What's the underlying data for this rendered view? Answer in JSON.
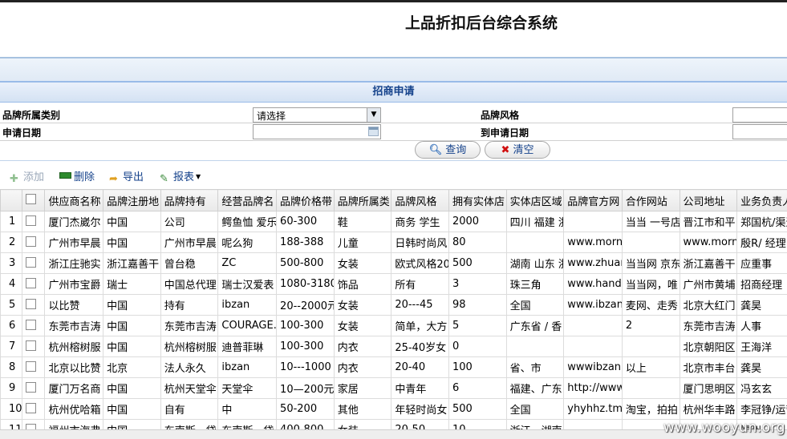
{
  "app": {
    "title": "上品折扣后台综合系统"
  },
  "search_panel": {
    "title": "招商申请",
    "brand_category_label": "品牌所属类别",
    "brand_category_value": "请选择",
    "brand_style_label": "品牌风格",
    "apply_date_label": "申请日期",
    "to_apply_date_label": "到申请日期",
    "search_button": "查询",
    "clear_button": "清空"
  },
  "toolbar": {
    "add": "添加",
    "delete": "删除",
    "export": "导出",
    "report": "报表"
  },
  "grid": {
    "columns": [
      "供应商名称",
      "品牌注册地",
      "品牌持有",
      "经营品牌名",
      "品牌价格带",
      "品牌所属类",
      "品牌风格",
      "拥有实体店",
      "实体店区域",
      "品牌官方网",
      "合作网站",
      "公司地址",
      "业务负责人"
    ],
    "rows": [
      {
        "n": "1",
        "c": [
          "厦门杰崴尔",
          "中国",
          "公司",
          "鳄鱼恤 爱乐",
          "60-300",
          "鞋",
          "商务 学生",
          "2000",
          "四川 福建 浙",
          "",
          "当当 一号店",
          "晋江市和平",
          "郑国杭/渠道"
        ]
      },
      {
        "n": "2",
        "c": [
          "广州市早晨",
          "中国",
          "广州市早晨",
          "呢么狗",
          "188-388",
          "儿童",
          "日韩时尚风",
          "80",
          "",
          "www.morn",
          "",
          "www.morn",
          "殷R/ 经理"
        ]
      },
      {
        "n": "3",
        "c": [
          "浙江庄驰实",
          "浙江嘉善干",
          "曾台稳",
          "ZC",
          "500-800",
          "女装",
          "欧式风格20",
          "500",
          "湖南 山东 浙",
          "www.zhuar",
          "当当网 京东",
          "浙江嘉善干",
          "应重事"
        ]
      },
      {
        "n": "4",
        "c": [
          "广州市宝爵",
          "瑞士",
          "中国总代理",
          "瑞士汉爱表",
          "1080-3180",
          "饰品",
          "所有",
          "3",
          "珠三角",
          "www.handl",
          "当当网，唯",
          "广州市黄埔",
          "招商经理"
        ]
      },
      {
        "n": "5",
        "c": [
          "以比赞",
          "中国",
          "持有",
          "ibzan",
          "20--2000元",
          "女装",
          "20---45",
          "98",
          "全国",
          "www.ibzan.",
          "麦网、走秀",
          "北京大红门",
          "龚昊"
        ]
      },
      {
        "n": "6",
        "c": [
          "东莞市吉涛",
          "中国",
          "东莞市吉涛",
          "COURAGE.",
          "100-300",
          "女装",
          "简单，大方",
          "5",
          "广东省 / 香",
          "",
          "2",
          "东莞市吉涛",
          "人事"
        ]
      },
      {
        "n": "7",
        "c": [
          "杭州榕树服",
          "中国",
          "杭州榕树服",
          "迪普菲琳",
          "100-300",
          "内衣",
          "25-40岁女",
          "0",
          "",
          "",
          "",
          "北京朝阳区",
          "王海洋"
        ]
      },
      {
        "n": "8",
        "c": [
          "北京以比赞",
          "北京",
          "法人永久",
          "ibzan",
          "10---1000",
          "内衣",
          "20-40",
          "100",
          "省、市",
          "wwwibzan.",
          "以上",
          "北京市丰台",
          "龚昊"
        ]
      },
      {
        "n": "9",
        "c": [
          "厦门万名商",
          "中国",
          "杭州天堂伞",
          "天堂伞",
          "10—200元",
          "家居",
          "中青年",
          "6",
          "福建、广东",
          "http://www",
          "",
          "厦门思明区",
          "冯玄玄"
        ]
      },
      {
        "n": "10",
        "c": [
          "杭州优哈箱",
          "中国",
          "自有",
          "中",
          "50-200",
          "其他",
          "年轻时尚女",
          "500",
          "全国",
          "yhyhhz.tma",
          "淘宝，拍拍",
          "杭州华丰路",
          "李冠铮/运营"
        ]
      },
      {
        "n": "11",
        "c": [
          "福州市海弗",
          "中国",
          "东南斯、袋",
          "东南斯、袋",
          "400-800",
          "女装",
          "20-50",
          "10",
          "浙江、湖南",
          "",
          "",
          "",
          "福州"
        ]
      }
    ]
  },
  "watermark": "www.wooyun.org"
}
